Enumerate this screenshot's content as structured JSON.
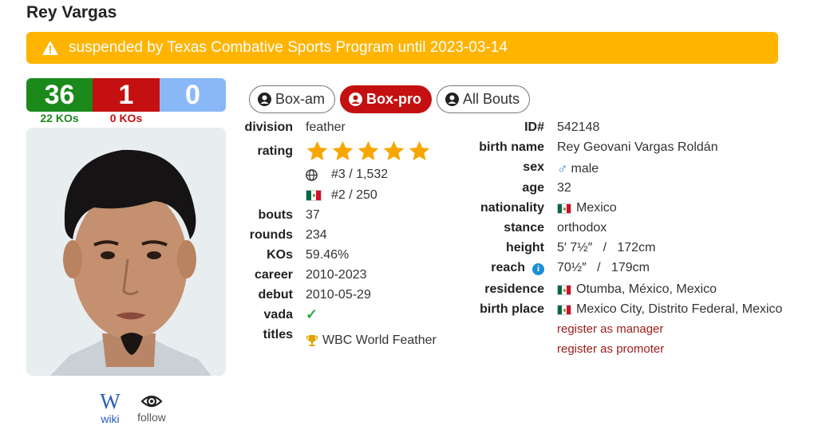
{
  "boxer": {
    "name": "Rey Vargas"
  },
  "alert": {
    "text": "suspended by Texas Combative Sports Program until 2023-03-14",
    "icon": "warning-icon"
  },
  "record": {
    "wins": "36",
    "losses": "1",
    "draws": "0",
    "wins_kos": "22 KOs",
    "losses_kos": "0 KOs"
  },
  "tabs": [
    {
      "label": "Box-am",
      "active": false
    },
    {
      "label": "Box-pro",
      "active": true
    },
    {
      "label": "All Bouts",
      "active": false
    }
  ],
  "links": {
    "wiki_label": "wiki",
    "wiki_glyph": "W",
    "follow_label": "follow"
  },
  "left_details": {
    "division": {
      "label": "division",
      "value": "feather"
    },
    "rating": {
      "label": "rating",
      "stars": 5,
      "world_rank": "#3 / 1,532",
      "country_rank": "#2 / 250"
    },
    "bouts": {
      "label": "bouts",
      "value": "37"
    },
    "rounds": {
      "label": "rounds",
      "value": "234"
    },
    "kos": {
      "label": "KOs",
      "value": "59.46%"
    },
    "career": {
      "label": "career",
      "value": "2010-2023"
    },
    "debut": {
      "label": "debut",
      "value": "2010-05-29"
    },
    "vada": {
      "label": "vada",
      "value": "✓"
    },
    "titles": {
      "label": "titles",
      "value": "WBC World Feather"
    }
  },
  "right_details": {
    "id": {
      "label": "ID#",
      "value": "542148"
    },
    "birth_name": {
      "label": "birth name",
      "value": "Rey Geovani Vargas Roldán"
    },
    "sex": {
      "label": "sex",
      "value": "male",
      "icon": "♂"
    },
    "age": {
      "label": "age",
      "value": "32"
    },
    "nationality": {
      "label": "nationality",
      "value": "Mexico"
    },
    "stance": {
      "label": "stance",
      "value": "orthodox"
    },
    "height": {
      "label": "height",
      "value": "5′ 7½″   /   172cm"
    },
    "reach": {
      "label": "reach",
      "value": "70½″   /   179cm"
    },
    "residence": {
      "label": "residence",
      "value": "Otumba, México, Mexico"
    },
    "birth_place": {
      "label": "birth place",
      "value": "Mexico City, Distrito Federal, Mexico"
    },
    "register_manager": "register as manager",
    "register_promoter": "register as promoter"
  },
  "colors": {
    "win": "#1b8a1b",
    "loss": "#c41010",
    "draw": "#8ab8f7",
    "alert": "#ffb400",
    "star": "#f7a600",
    "link": "#9b1b1b"
  }
}
